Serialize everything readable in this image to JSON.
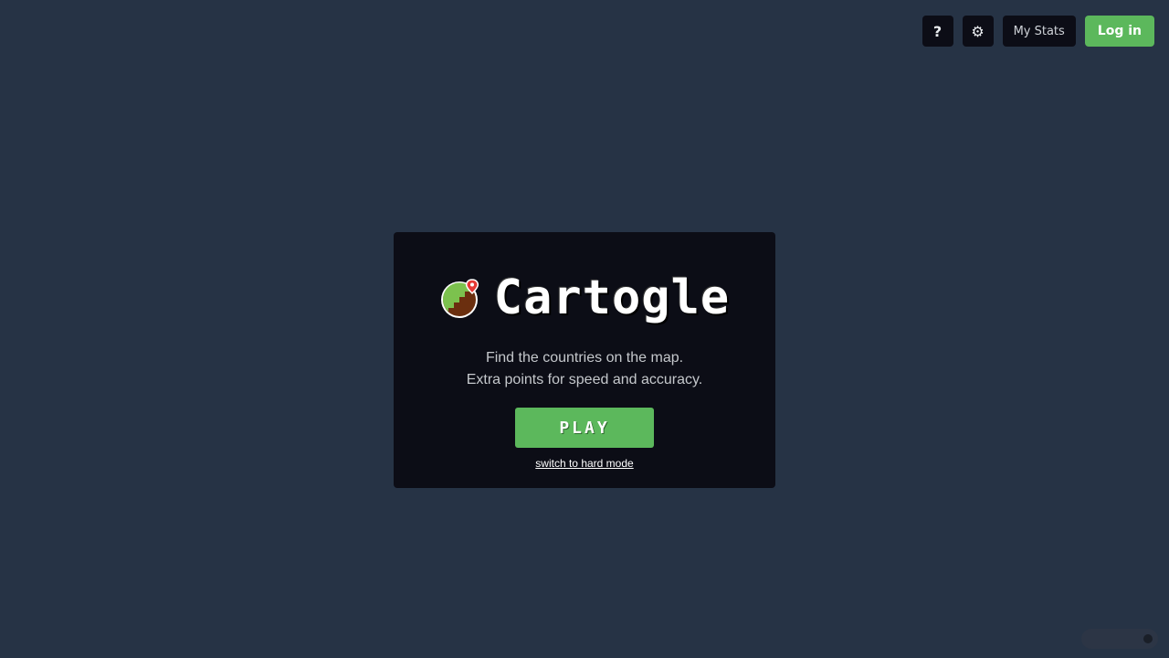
{
  "header": {
    "help_label": "?",
    "settings_icon": "⚙",
    "stats_label": "My Stats",
    "login_label": "Log in"
  },
  "card": {
    "title": "Cartogle",
    "description_line1": "Find the countries on the map.",
    "description_line2": "Extra points for speed and accuracy.",
    "play_label": "PLAY",
    "hard_mode_link": "switch to hard mode"
  },
  "colors": {
    "background": "#263345",
    "card": "#0c0d16",
    "accent_green": "#5cb85c",
    "earth_brown": "#6b2f0f",
    "pin_red": "#e53935"
  },
  "icons": {
    "logo": "globe-pin-icon",
    "settings": "gear-icon",
    "help": "question-icon"
  }
}
